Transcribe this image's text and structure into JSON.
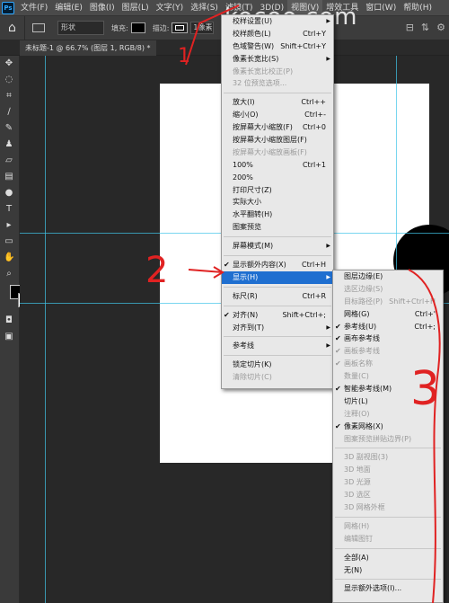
{
  "watermark": "kocoo.com",
  "menubar": {
    "logo": "Ps",
    "items": [
      "文件(F)",
      "编辑(E)",
      "图像(I)",
      "图层(L)",
      "文字(Y)",
      "选择(S)",
      "滤镜(T)",
      "3D(D)",
      "视图(V)",
      "增效工具",
      "窗口(W)",
      "帮助(H)"
    ]
  },
  "options": {
    "mode_value": "形状",
    "fill_label": "填充:",
    "stroke_label": "描边:",
    "stroke_size": "1像素"
  },
  "tab": {
    "title": "未标题-1 @ 66.7% (图层 1, RGB/8) *"
  },
  "view_menu": {
    "items": [
      {
        "label": "校样设置(U)",
        "shortcut": "",
        "arrow": true,
        "disabled": false
      },
      {
        "label": "校样颜色(L)",
        "shortcut": "Ctrl+Y",
        "disabled": false
      },
      {
        "label": "色域警告(W)",
        "shortcut": "Shift+Ctrl+Y",
        "disabled": false
      },
      {
        "label": "像素长宽比(S)",
        "shortcut": "",
        "arrow": true,
        "disabled": false
      },
      {
        "label": "像素长宽比校正(P)",
        "shortcut": "",
        "disabled": true
      },
      {
        "label": "32 位预览选项...",
        "shortcut": "",
        "disabled": true
      },
      {
        "sep": true
      },
      {
        "label": "放大(I)",
        "shortcut": "Ctrl++",
        "disabled": false
      },
      {
        "label": "缩小(O)",
        "shortcut": "Ctrl+-",
        "disabled": false
      },
      {
        "label": "按屏幕大小缩放(F)",
        "shortcut": "Ctrl+0",
        "disabled": false
      },
      {
        "label": "按屏幕大小缩放图层(F)",
        "shortcut": "",
        "disabled": false
      },
      {
        "label": "按屏幕大小缩放画板(F)",
        "shortcut": "",
        "disabled": true
      },
      {
        "label": "100%",
        "shortcut": "Ctrl+1",
        "disabled": false
      },
      {
        "label": "200%",
        "shortcut": "",
        "disabled": false
      },
      {
        "label": "打印尺寸(Z)",
        "shortcut": "",
        "disabled": false
      },
      {
        "label": "实际大小",
        "shortcut": "",
        "disabled": false
      },
      {
        "label": "水平翻转(H)",
        "shortcut": "",
        "disabled": false
      },
      {
        "label": "图案预览",
        "shortcut": "",
        "disabled": false
      },
      {
        "sep": true
      },
      {
        "label": "屏幕模式(M)",
        "shortcut": "",
        "arrow": true,
        "disabled": false
      },
      {
        "sep": true
      },
      {
        "label": "显示额外内容(X)",
        "shortcut": "Ctrl+H",
        "checked": true,
        "disabled": false
      },
      {
        "label": "显示(H)",
        "shortcut": "",
        "arrow": true,
        "highlighted": true,
        "disabled": false
      },
      {
        "sep": true
      },
      {
        "label": "标尺(R)",
        "shortcut": "Ctrl+R",
        "disabled": false
      },
      {
        "sep": true
      },
      {
        "label": "对齐(N)",
        "shortcut": "Shift+Ctrl+;",
        "checked": true,
        "disabled": false
      },
      {
        "label": "对齐到(T)",
        "shortcut": "",
        "arrow": true,
        "disabled": false
      },
      {
        "sep": true
      },
      {
        "label": "参考线",
        "shortcut": "",
        "arrow": true,
        "disabled": false
      },
      {
        "sep": true
      },
      {
        "label": "锁定切片(K)",
        "shortcut": "",
        "disabled": false
      },
      {
        "label": "清除切片(C)",
        "shortcut": "",
        "disabled": true
      }
    ]
  },
  "show_submenu": {
    "items": [
      {
        "label": "图层边缘(E)",
        "shortcut": "",
        "disabled": false
      },
      {
        "label": "选区边缘(S)",
        "shortcut": "",
        "disabled": true
      },
      {
        "label": "目标路径(P)",
        "shortcut": "Shift+Ctrl+H",
        "disabled": true
      },
      {
        "label": "网格(G)",
        "shortcut": "Ctrl+'",
        "disabled": false
      },
      {
        "label": "参考线(U)",
        "shortcut": "Ctrl+;",
        "checked": true,
        "disabled": false
      },
      {
        "label": "画布参考线",
        "shortcut": "",
        "checked": true,
        "disabled": false
      },
      {
        "label": "画板参考线",
        "shortcut": "",
        "checked": true,
        "disabled": true
      },
      {
        "label": "画板名称",
        "shortcut": "",
        "checked": true,
        "disabled": true
      },
      {
        "label": "数量(C)",
        "shortcut": "",
        "disabled": true
      },
      {
        "label": "智能参考线(M)",
        "shortcut": "",
        "checked": true,
        "disabled": false
      },
      {
        "label": "切片(L)",
        "shortcut": "",
        "disabled": false
      },
      {
        "label": "注释(O)",
        "shortcut": "",
        "disabled": true
      },
      {
        "label": "像素网格(X)",
        "shortcut": "",
        "checked": true,
        "disabled": false
      },
      {
        "label": "图案预览拼贴边界(P)",
        "shortcut": "",
        "disabled": true
      },
      {
        "sep": true
      },
      {
        "label": "3D 副视图(3)",
        "shortcut": "",
        "disabled": true
      },
      {
        "label": "3D 地面",
        "shortcut": "",
        "disabled": true
      },
      {
        "label": "3D 光源",
        "shortcut": "",
        "disabled": true
      },
      {
        "label": "3D 选区",
        "shortcut": "",
        "disabled": true
      },
      {
        "label": "3D 网格外框",
        "shortcut": "",
        "disabled": true
      },
      {
        "sep": true
      },
      {
        "label": "网格(H)",
        "shortcut": "",
        "disabled": true
      },
      {
        "label": "编辑图钉",
        "shortcut": "",
        "disabled": true
      },
      {
        "sep": true
      },
      {
        "label": "全部(A)",
        "shortcut": "",
        "disabled": false
      },
      {
        "label": "无(N)",
        "shortcut": "",
        "disabled": false
      },
      {
        "sep": true
      },
      {
        "label": "显示额外选项(I)...",
        "shortcut": "",
        "disabled": false
      }
    ]
  },
  "annotations": {
    "one": "1",
    "two": "2",
    "three": "3"
  },
  "colors": {
    "highlight": "#1f6fd0",
    "guide": "#40c4e8",
    "annotation": "#e02222"
  }
}
